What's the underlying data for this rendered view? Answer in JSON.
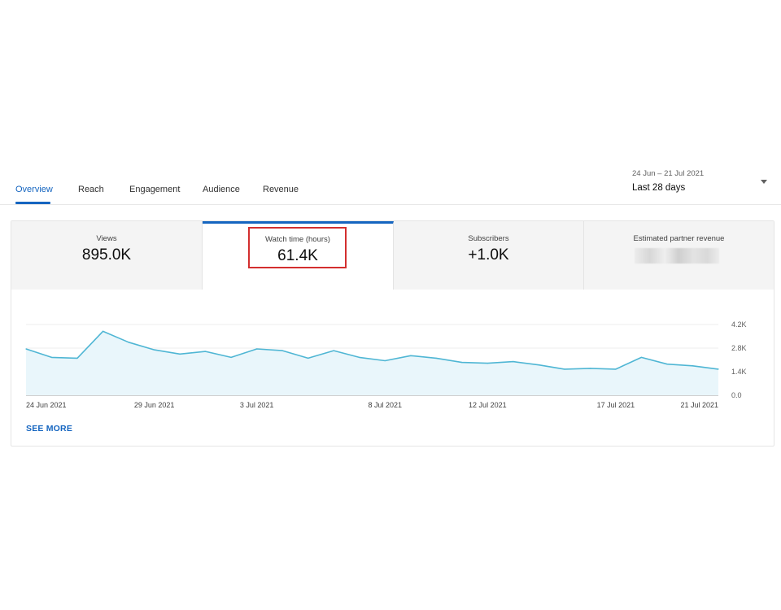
{
  "tabs": [
    {
      "label": "Overview",
      "active": true
    },
    {
      "label": "Reach",
      "active": false
    },
    {
      "label": "Engagement",
      "active": false
    },
    {
      "label": "Audience",
      "active": false
    },
    {
      "label": "Revenue",
      "active": false
    }
  ],
  "date_range": {
    "range": "24 Jun – 21 Jul 2021",
    "period": "Last 28 days",
    "icon": "caret-down-icon"
  },
  "metrics": [
    {
      "label": "Views",
      "value": "895.0K"
    },
    {
      "label": "Watch time (hours)",
      "value": "61.4K",
      "selected": true
    },
    {
      "label": "Subscribers",
      "value": "+1.0K"
    },
    {
      "label": "Estimated partner revenue",
      "value": ""
    }
  ],
  "see_more_label": "SEE MORE",
  "colors": {
    "accent": "#1565c0",
    "line": "#4fb6d4",
    "area": "#e9f6fb",
    "highlight": "#d32f2f"
  },
  "chart_data": {
    "type": "area",
    "x": [
      "24 Jun 2021",
      "25 Jun 2021",
      "26 Jun 2021",
      "27 Jun 2021",
      "28 Jun 2021",
      "29 Jun 2021",
      "30 Jun 2021",
      "1 Jul 2021",
      "2 Jul 2021",
      "3 Jul 2021",
      "4 Jul 2021",
      "5 Jul 2021",
      "6 Jul 2021",
      "7 Jul 2021",
      "8 Jul 2021",
      "9 Jul 2021",
      "10 Jul 2021",
      "11 Jul 2021",
      "12 Jul 2021",
      "13 Jul 2021",
      "14 Jul 2021",
      "15 Jul 2021",
      "16 Jul 2021",
      "17 Jul 2021",
      "18 Jul 2021",
      "19 Jul 2021",
      "20 Jul 2021",
      "21 Jul 2021"
    ],
    "series": [
      {
        "values": [
          2.75,
          2.25,
          2.2,
          3.8,
          3.15,
          2.7,
          2.45,
          2.6,
          2.25,
          2.75,
          2.65,
          2.2,
          2.65,
          2.25,
          2.05,
          2.35,
          2.2,
          1.95,
          1.9,
          2.0,
          1.8,
          1.55,
          1.6,
          1.55,
          2.25,
          1.85,
          1.75,
          1.55
        ]
      }
    ],
    "xticks": [
      "24 Jun 2021",
      "29 Jun 2021",
      "3 Jul 2021",
      "8 Jul 2021",
      "12 Jul 2021",
      "17 Jul 2021",
      "21 Jul 2021"
    ],
    "ylim": [
      0,
      4.2
    ],
    "yticks": [
      0,
      1.4,
      2.8,
      4.2
    ],
    "ytick_labels": [
      "0.0",
      "1.4K",
      "2.8K",
      "4.2K"
    ],
    "grid": true
  }
}
